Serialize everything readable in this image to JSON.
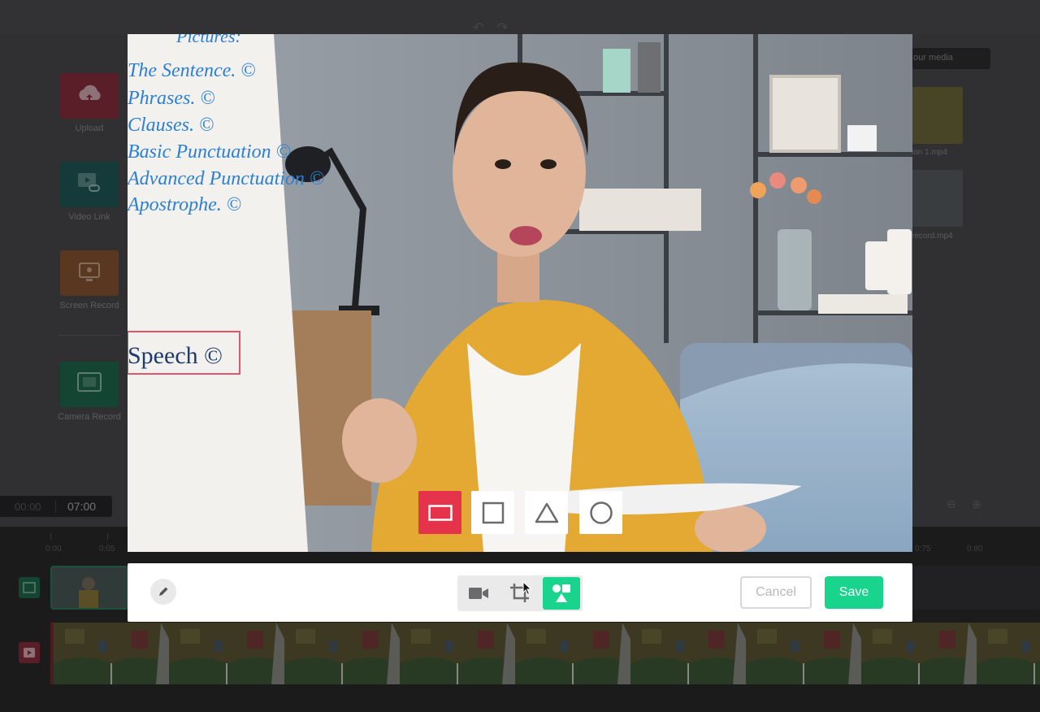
{
  "left_panel": {
    "tools": [
      {
        "label": "Upload",
        "color": "#8a2f3f"
      },
      {
        "label": "Video Link",
        "color": "#1f5a5a"
      },
      {
        "label": "Screen Record",
        "color": "#8a5532"
      },
      {
        "label": "Camera Record",
        "color": "#1f6a4f"
      }
    ]
  },
  "right_panel": {
    "media_button": "our media",
    "media_items": [
      {
        "name": "ion 1.mp4"
      },
      {
        "name": "record.mp4"
      }
    ]
  },
  "timecode": {
    "current": "00:00",
    "total": "07:00"
  },
  "timeline": {
    "ruler_labels": [
      "0:00",
      "0:05",
      "0:75",
      "0:80"
    ]
  },
  "whiteboard": {
    "lines": [
      "The Sentence. ©",
      "Phrases. ©",
      "Clauses. ©",
      "Basic Punctuation ©",
      "Advanced Punctuation ©",
      "Apostrophe. ©"
    ],
    "boxed": "Speech ©",
    "header": "Pictures:"
  },
  "shapes": {
    "options": [
      {
        "name": "rectangle",
        "active": true
      },
      {
        "name": "square",
        "active": false
      },
      {
        "name": "triangle",
        "active": false
      },
      {
        "name": "circle",
        "active": false
      }
    ]
  },
  "crop_toolbar": {
    "modes": [
      {
        "name": "video-camera-icon",
        "active": false
      },
      {
        "name": "crop-icon",
        "active": false
      },
      {
        "name": "shapes-icon",
        "active": true
      }
    ],
    "cancel_label": "Cancel",
    "save_label": "Save"
  },
  "colors": {
    "accent": "#18d48d",
    "shape_active": "#e6334c"
  }
}
